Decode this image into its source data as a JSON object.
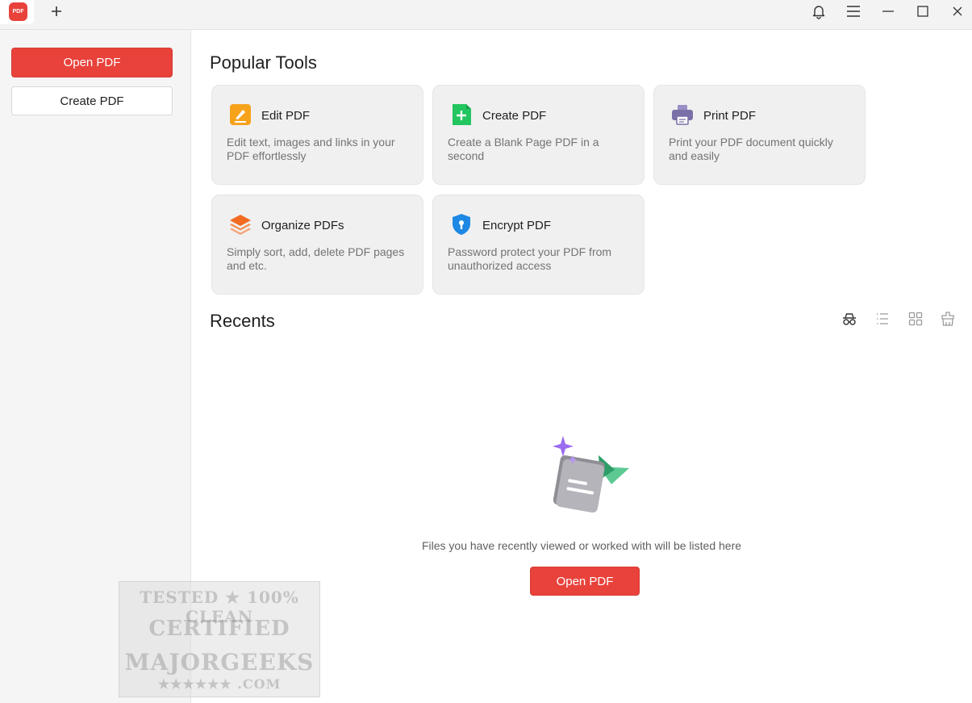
{
  "titlebar": {
    "logo_text": "PDF",
    "icons": [
      "plus-icon",
      "bell-icon",
      "menu-icon",
      "minimize-icon",
      "maximize-icon",
      "close-icon"
    ]
  },
  "sidebar": {
    "open_label": "Open PDF",
    "create_label": "Create PDF"
  },
  "popular_tools": {
    "title": "Popular Tools",
    "tools": [
      {
        "title": "Edit PDF",
        "desc": "Edit text, images and links in your PDF effortlessly",
        "icon": "edit-icon",
        "color": "#f7a21b"
      },
      {
        "title": "Create PDF",
        "desc": "Create a Blank Page PDF in a second",
        "icon": "create-icon",
        "color": "#22c55e"
      },
      {
        "title": "Print PDF",
        "desc": "Print your PDF document quickly and easily",
        "icon": "printer-icon",
        "color": "#7b6fa8"
      },
      {
        "title": "Organize PDFs",
        "desc": "Simply sort, add, delete PDF pages and etc.",
        "icon": "layers-icon",
        "color": "#f26b21"
      },
      {
        "title": "Encrypt PDF",
        "desc": "Password protect your PDF from unauthorized access",
        "icon": "shield-icon",
        "color": "#1e88e5"
      }
    ]
  },
  "recents": {
    "title": "Recents",
    "empty_text": "Files you have recently viewed or worked with will be listed here",
    "open_label": "Open PDF",
    "view_icons": [
      "incognito-icon",
      "list-view-icon",
      "grid-view-icon",
      "clear-icon"
    ]
  },
  "watermark": {
    "line1": "TESTED ★ 100% CLEAN",
    "line2": "CERTIFIED",
    "line3": "MAJORGEEKS",
    "line4": "★★★★★★ .COM"
  },
  "colors": {
    "accent": "#e8423b",
    "sidebar_bg": "#f5f5f5",
    "card_bg": "#f0f0f0"
  }
}
